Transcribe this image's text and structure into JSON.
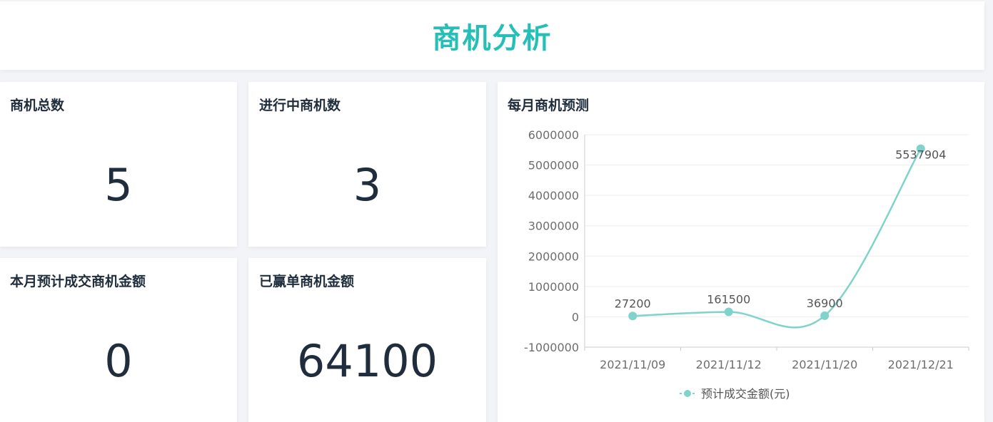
{
  "header": {
    "title": "商机分析"
  },
  "cards": [
    {
      "title": "商机总数",
      "value": "5"
    },
    {
      "title": "进行中商机数",
      "value": "3"
    },
    {
      "title": "本月预计成交商机金额",
      "value": "0"
    },
    {
      "title": "已赢单商机金额",
      "value": "64100"
    }
  ],
  "chart_panel": {
    "title": "每月商机预测"
  },
  "chart_data": {
    "type": "line",
    "title": "每月商机预测",
    "categories": [
      "2021/11/09",
      "2021/11/12",
      "2021/11/20",
      "2021/12/21"
    ],
    "series": [
      {
        "name": "预计成交金额(元)",
        "values": [
          27200,
          161500,
          36900,
          5537904
        ],
        "color": "#7fd3cb"
      }
    ],
    "ylim": [
      -1000000,
      6000000
    ],
    "yticks": [
      6000000,
      5000000,
      4000000,
      3000000,
      2000000,
      1000000,
      0,
      -1000000
    ],
    "smooth": true,
    "grid": true,
    "legend_position": "bottom-center"
  },
  "colors": {
    "accent": "#25bfb7",
    "line": "#7fd3cb",
    "text": "#1f2d3d"
  }
}
